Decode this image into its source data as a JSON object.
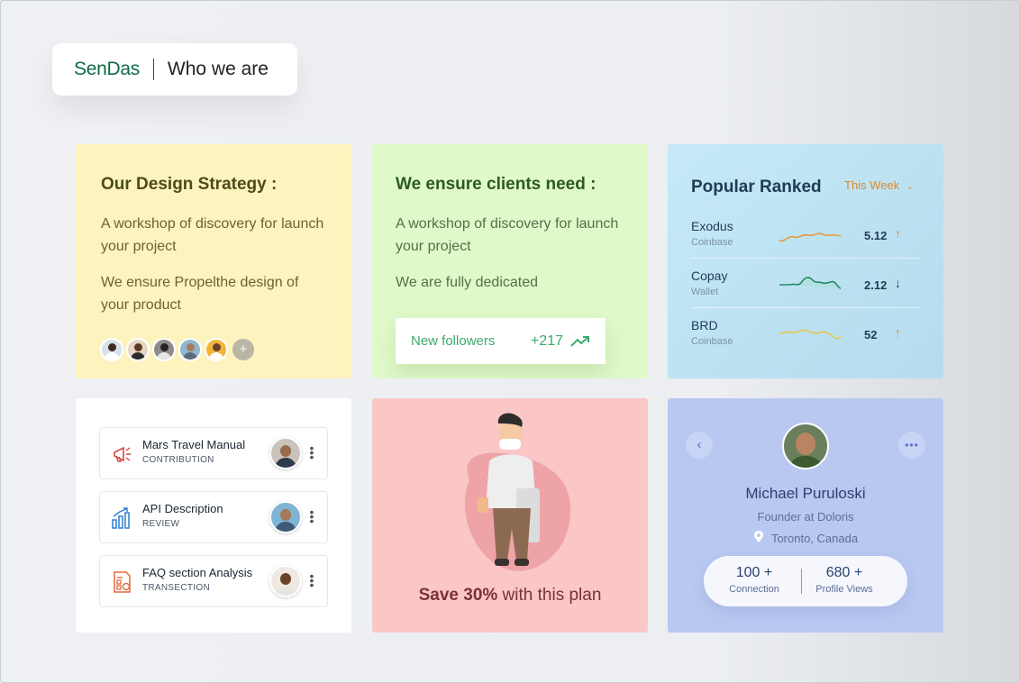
{
  "brand": {
    "logo": "SenDas",
    "tagline": "Who we are"
  },
  "strategy": {
    "title": "Our Design Strategy :",
    "paragraphs": [
      "A workshop of discovery for launch your project",
      "We ensure Propelthe design of your product"
    ],
    "more_avatars": "+"
  },
  "clients": {
    "title": "We ensure clients need :",
    "paragraphs": [
      "A workshop of discovery for launch your project",
      "We are fully dedicated"
    ],
    "followers_label": "New followers",
    "followers_value": "+217"
  },
  "ranked": {
    "title": "Popular Ranked",
    "filter": "This Week",
    "items": [
      {
        "name": "Exodus",
        "source": "Coinbase",
        "value": "5.12",
        "trend": "up",
        "color": "#e69a3d"
      },
      {
        "name": "Copay",
        "source": "Wallet",
        "value": "2.12",
        "trend": "down",
        "color": "#2a8a66"
      },
      {
        "name": "BRD",
        "source": "Coinbase",
        "value": "52",
        "trend": "up",
        "color": "#e6c74a"
      }
    ]
  },
  "tasks": [
    {
      "title": "Mars Travel Manual",
      "type": "CONTRIBUTION",
      "icon": "megaphone-icon"
    },
    {
      "title": "API Description",
      "type": "REVIEW",
      "icon": "bar-chart-icon"
    },
    {
      "title": "FAQ section Analysis",
      "type": "TRANSECTION",
      "icon": "report-icon"
    }
  ],
  "promo": {
    "bold": "Save 30%",
    "rest": " with this plan"
  },
  "profile": {
    "name": "Michael Puruloski",
    "role": "Founder at Doloris",
    "location": "Toronto, Canada",
    "connections_value": "100 +",
    "connections_label": "Connection",
    "views_value": "680 +",
    "views_label": "Profile Views"
  },
  "colors": {
    "brand": "#0f6b46",
    "accent_green": "#3da96a",
    "accent_orange": "#d9892e"
  }
}
